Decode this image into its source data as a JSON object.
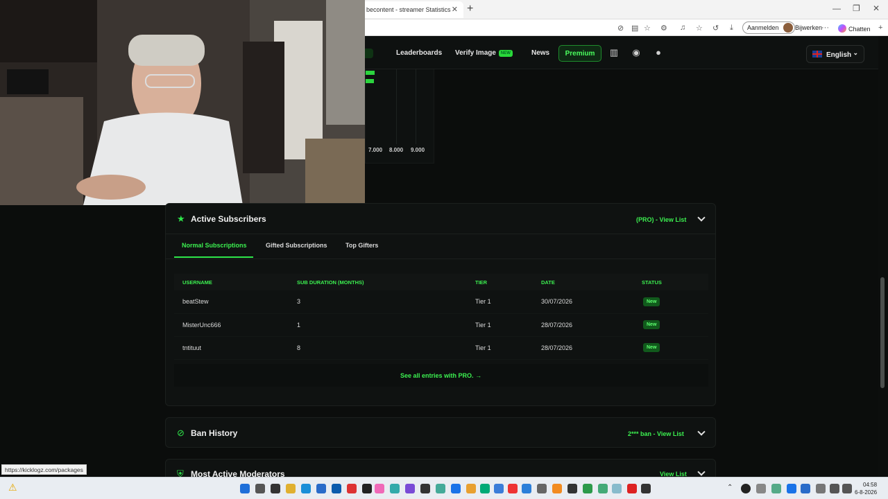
{
  "browser": {
    "tab_title": "becontent - streamer Statistics",
    "signin_label": "Aanmelden",
    "update_label": "Bijwerken",
    "chat_label": "Chatten"
  },
  "nav": {
    "items": [
      {
        "label": "Leaderboards"
      },
      {
        "label": "Verify Image",
        "badge": "NEW"
      },
      {
        "label": "News"
      }
    ],
    "premium_label": "Premium",
    "language": "English"
  },
  "chart_fragment": {
    "ticks": [
      "7.000",
      "8.000",
      "9.000"
    ]
  },
  "subscribers": {
    "title": "Active Subscribers",
    "view_link": "(PRO) - View List",
    "tabs": [
      "Normal Subscriptions",
      "Gifted Subscriptions",
      "Top Gifters"
    ],
    "columns": [
      "USERNAME",
      "SUB DURATION (MONTHS)",
      "TIER",
      "DATE",
      "STATUS"
    ],
    "rows": [
      {
        "username": "beatStew",
        "duration": "3",
        "tier": "Tier 1",
        "date": "30/07/2026",
        "status": "New"
      },
      {
        "username": "MisterUnc666",
        "duration": "1",
        "tier": "Tier 1",
        "date": "28/07/2026",
        "status": "New"
      },
      {
        "username": "tntituut",
        "duration": "8",
        "tier": "Tier 1",
        "date": "28/07/2026",
        "status": "New"
      }
    ],
    "see_all": "See all entries with PRO."
  },
  "ban_history": {
    "title": "Ban History",
    "view_link": "2*** ban - View List"
  },
  "moderators": {
    "title": "Most Active Moderators",
    "view_link": "View List"
  },
  "status_url": "https://kicklogz.com/packages",
  "clock": {
    "time": "04:58",
    "date": "6-8-2026"
  },
  "colors": {
    "accent": "#2ee64a",
    "background": "#0b0d0c",
    "panel": "#0f1211"
  }
}
